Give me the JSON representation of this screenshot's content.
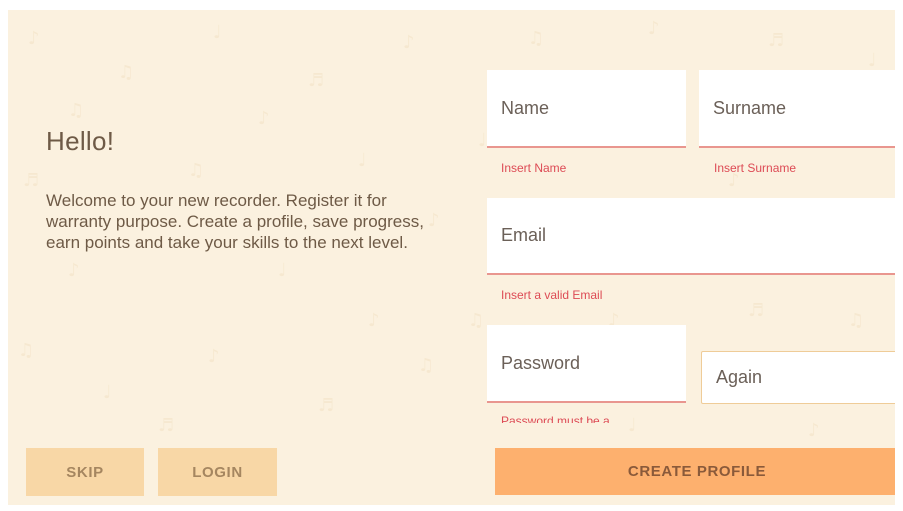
{
  "intro": {
    "title": "Hello!",
    "text": "Welcome to your new recorder. Register it for warranty purpose. Create a profile, save progress, earn points and take your skills to the next level."
  },
  "form": {
    "name": {
      "placeholder": "Name",
      "error": "Insert Name"
    },
    "surname": {
      "placeholder": "Surname",
      "error": "Insert Surname"
    },
    "email": {
      "placeholder": "Email",
      "error": "Insert a valid Email"
    },
    "password": {
      "placeholder": "Password",
      "error": "Password must be a"
    },
    "password_again": {
      "placeholder": "Again"
    }
  },
  "buttons": {
    "skip": "SKIP",
    "login": "LOGIN",
    "create_profile": "CREATE PROFILE"
  },
  "colors": {
    "background": "#fbf1df",
    "text": "#6e5a46",
    "error": "#dd4b55",
    "underline": "#e9968f",
    "primary_button": "#fdb06e",
    "secondary_button": "#f8d7a6"
  }
}
